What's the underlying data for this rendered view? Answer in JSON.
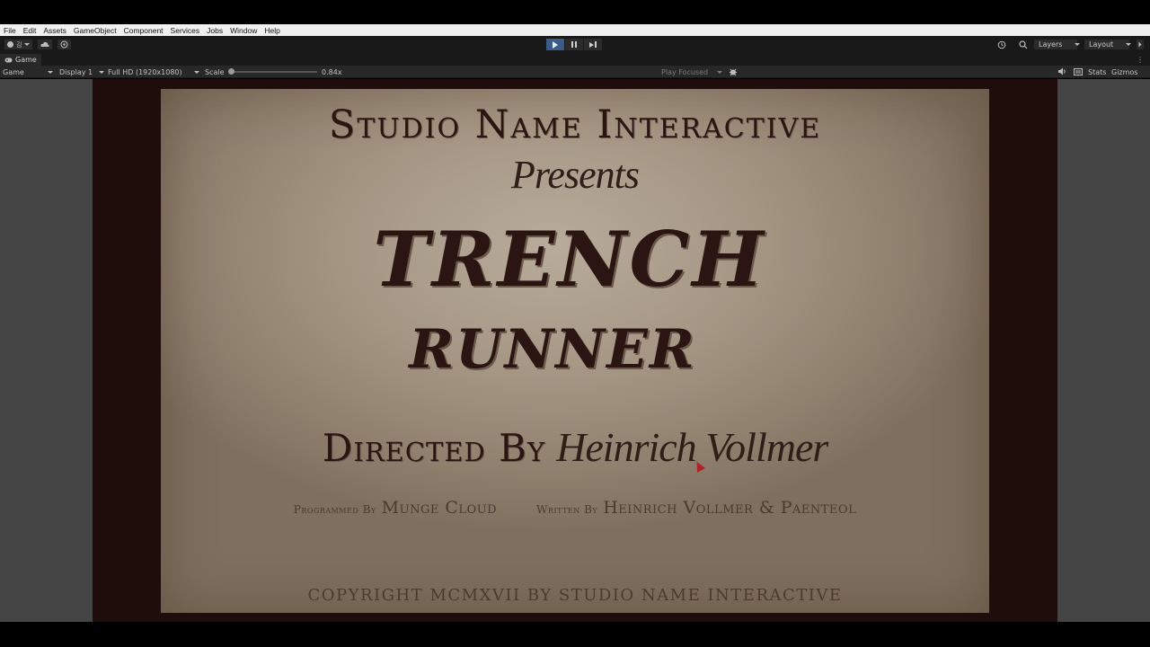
{
  "menu": [
    "File",
    "Edit",
    "Assets",
    "GameObject",
    "Component",
    "Services",
    "Jobs",
    "Window",
    "Help"
  ],
  "toolbar": {
    "account_label": "김",
    "layers_label": "Layers",
    "layout_label": "Layout"
  },
  "tab": {
    "title": "Game"
  },
  "gamebar": {
    "view_label": "Game",
    "display_label": "Display 1",
    "resolution_label": "Full HD (1920x1080)",
    "scale_label": "Scale",
    "scale_value": "0.84x",
    "play_focused_label": "Play Focused",
    "stats_label": "Stats",
    "gizmos_label": "Gizmos"
  },
  "title_card": {
    "studio": "Studio Name Interactive",
    "presents": "Presents",
    "title_line1": "TRENCH",
    "title_line2": "RUNNER",
    "directed_label": "Directed By",
    "director": "Heinrich Vollmer",
    "programmed_label": "Programmed By",
    "programmer": "Munge Cloud",
    "written_label": "Written By",
    "writers": "Heinrich Vollmer & Paenteol",
    "copyright": "COPYRIGHT MCMXVII BY STUDIO NAME INTERACTIVE"
  },
  "colors": {
    "play_active": "#3b5b8a",
    "card_ink": "#2a1512",
    "cursor": "#b3202a"
  }
}
